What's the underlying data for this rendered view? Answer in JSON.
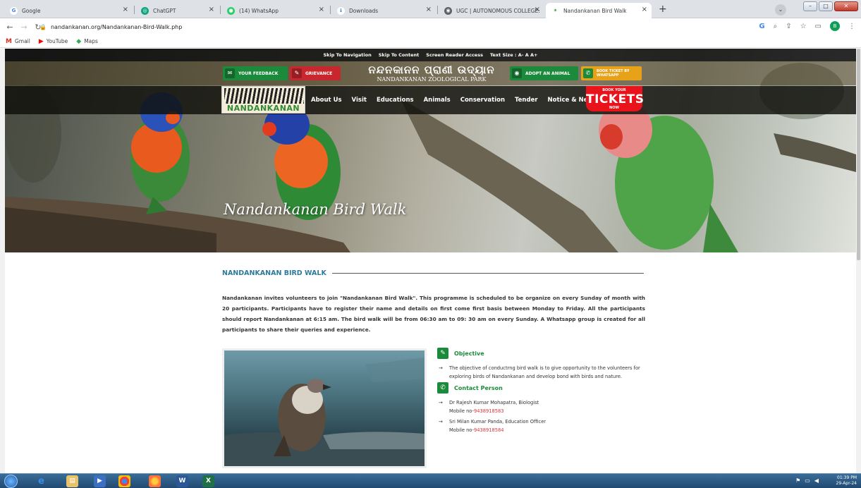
{
  "browser": {
    "tabs": [
      {
        "label": "Google",
        "icon": "google-icon",
        "color": "#4285f4",
        "glyph": "G"
      },
      {
        "label": "ChatGPT",
        "icon": "chatgpt-icon",
        "color": "#10a37f",
        "glyph": "◎"
      },
      {
        "label": "(14) WhatsApp",
        "icon": "whatsapp-icon",
        "color": "#25d366",
        "glyph": "●"
      },
      {
        "label": "Downloads",
        "icon": "download-icon",
        "color": "#1a73e8",
        "glyph": "↓"
      },
      {
        "label": "UGC | AUTONOMOUS COLLEGE:",
        "icon": "globe-icon",
        "color": "#5f6368",
        "glyph": "◉"
      },
      {
        "label": "Nandankanan Bird Walk",
        "icon": "nandankanan-favicon",
        "color": "#2f8a32",
        "glyph": "✶"
      }
    ],
    "url": "nandankanan.org/Nandankanan-Bird-Walk.php",
    "bookmarks": [
      {
        "label": "Gmail",
        "glyph": "M",
        "color": "#d93025"
      },
      {
        "label": "YouTube",
        "glyph": "▶",
        "color": "#ff0000"
      },
      {
        "label": "Maps",
        "glyph": "◆",
        "color": "#34a853"
      }
    ],
    "profile_initial": "B"
  },
  "site": {
    "topstrip": [
      "Skip To Navigation",
      "Skip To Content",
      "Screen Reader Access",
      "Text Size : A- A A+"
    ],
    "feedback": "YOUR FEEDBACK",
    "grievance": "GRIEVANCE",
    "park_odia": "ନନ୍ଦନକାନନ ପ୍ରାଣୀ ଉଦ୍ୟାନ",
    "park_english": "NANDANKANAN ZOOLOGICAL PARK",
    "adopt": "ADOPT AN ANIMAL",
    "book_whatsapp": "BOOK TICKET BY WHATSAPP",
    "logo_text": "NANDANKANAN",
    "menu": [
      "About Us",
      "Visit",
      "Educations",
      "Animals",
      "Conservation",
      "Tender",
      "Notice & News"
    ],
    "tickets": {
      "top": "BOOK YOUR",
      "main": "TICKETS",
      "bottom": "NOW"
    },
    "hero_title": "Nandankanan Bird Walk",
    "colors": {
      "green": "#1b8a3a",
      "red": "#e8131b",
      "heading_blue": "#2d7a9c"
    }
  },
  "content": {
    "section_title": "NANDANKANAN BIRD WALK",
    "intro": "Nandankanan invites volunteers to join \"Nandankanan Bird Walk\". This programme is scheduled to be organize on every Sunday of month with 20 participants. Participants have to register their name and details on first come first basis between Monday to Friday. All the participants should report Nandankanan at 6:15 am. The bird walk will be from 06:30 am to 09: 30 am on every Sunday. A Whatsapp group is created for all participants to share their queries and experience.",
    "objective_title": "Objective",
    "objective_text": "The objective of conductrng bird walk is to give opportunity to the volunteers for exploring birds of Nandankanan and develop bond with birds and nature.",
    "contact_title": "Contact Person",
    "contacts": [
      {
        "name": "Dr Rajesh Kumar Mohapatra, Biologist",
        "mobile_label": "Mobile no-",
        "mobile": "9438918583"
      },
      {
        "name": "Sri Milan Kumar Panda, Education Officer",
        "mobile_label": "Mobile no-",
        "mobile": "9438918584"
      }
    ]
  },
  "taskbar": {
    "time": "01:39 PM",
    "date": "29-Apr-24"
  }
}
